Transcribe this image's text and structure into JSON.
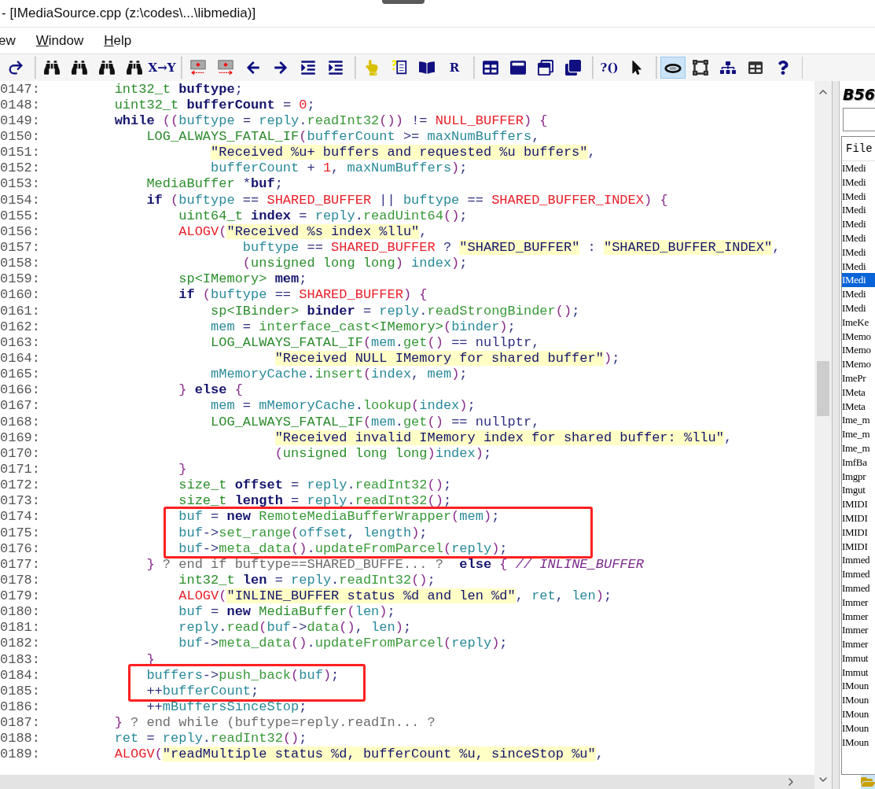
{
  "window": {
    "title": "- [IMediaSource.cpp (z:\\codes\\...\\libmedia)]"
  },
  "menu": [
    {
      "label": "ew",
      "underlined": false
    },
    {
      "label": "Window",
      "underlined": true
    },
    {
      "label": "Help",
      "underlined": true
    }
  ],
  "toolbar": [
    [
      {
        "selected": false
      }
    ],
    [
      {
        "selected": false
      },
      {
        "selected": false
      },
      {
        "selected": false
      },
      {
        "selected": false
      },
      {
        "label": "X→Y",
        "selected": false
      }
    ],
    [
      {
        "selected": false
      },
      {
        "selected": false
      },
      {
        "selected": false
      },
      {
        "selected": false
      },
      {
        "selected": false
      },
      {
        "selected": false
      }
    ],
    [
      {
        "selected": false
      },
      {
        "selected": false
      },
      {
        "selected": false
      },
      {
        "label": "R",
        "selected": false
      }
    ],
    [
      {
        "selected": false
      },
      {
        "selected": false
      },
      {
        "selected": false
      },
      {
        "selected": false
      }
    ],
    [
      {
        "label": "?()",
        "selected": false
      },
      {
        "selected": false
      }
    ],
    [
      {
        "selected": true
      },
      {
        "selected": false
      },
      {
        "selected": false
      },
      {
        "selected": false
      },
      {
        "selected": false
      }
    ]
  ],
  "editor": {
    "lines": [
      {
        "number": "0147:",
        "tokens": [
          {
            "kind": "type",
            "text": "        int32_t "
          },
          {
            "kind": "decl",
            "text": "buftype"
          },
          {
            "kind": "op",
            "text": ";"
          }
        ]
      },
      {
        "number": "0148:",
        "tokens": [
          {
            "kind": "type",
            "text": "        uint32_t "
          },
          {
            "kind": "decl",
            "text": "bufferCount"
          },
          {
            "kind": "op",
            "text": " = "
          },
          {
            "kind": "const",
            "text": "0"
          },
          {
            "kind": "op",
            "text": ";"
          }
        ]
      },
      {
        "number": "0149:",
        "tokens": [
          {
            "kind": "kw",
            "text": "        while "
          },
          {
            "kind": "punct",
            "text": "(("
          },
          {
            "kind": "var",
            "text": "buftype"
          },
          {
            "kind": "op",
            "text": " = "
          },
          {
            "kind": "var",
            "text": "reply"
          },
          {
            "kind": "op",
            "text": "."
          },
          {
            "kind": "func",
            "text": "readInt32"
          },
          {
            "kind": "punct",
            "text": "())"
          },
          {
            "kind": "op",
            "text": " != "
          },
          {
            "kind": "const",
            "text": "NULL_BUFFER"
          },
          {
            "kind": "punct",
            "text": ") {"
          }
        ]
      },
      {
        "number": "0150:",
        "tokens": [
          {
            "kind": "macro",
            "text": "            LOG_ALWAYS_FATAL_IF"
          },
          {
            "kind": "punct",
            "text": "("
          },
          {
            "kind": "var",
            "text": "bufferCount"
          },
          {
            "kind": "op",
            "text": " >= "
          },
          {
            "kind": "var",
            "text": "maxNumBuffers"
          },
          {
            "kind": "op",
            "text": ","
          }
        ]
      },
      {
        "number": "0151:",
        "tokens": [
          {
            "kind": "str",
            "text": "                    \"Received %u+ buffers and requested %u buffers\""
          },
          {
            "kind": "op",
            "text": ","
          }
        ]
      },
      {
        "number": "0152:",
        "tokens": [
          {
            "kind": "var",
            "text": "                    bufferCount"
          },
          {
            "kind": "op",
            "text": " + "
          },
          {
            "kind": "const",
            "text": "1"
          },
          {
            "kind": "op",
            "text": ", "
          },
          {
            "kind": "var",
            "text": "maxNumBuffers"
          },
          {
            "kind": "punct",
            "text": ")"
          },
          {
            "kind": "op",
            "text": ";"
          }
        ]
      },
      {
        "number": "0153:",
        "tokens": [
          {
            "kind": "type",
            "text": "            MediaBuffer"
          },
          {
            "kind": "op",
            "text": " *"
          },
          {
            "kind": "decl",
            "text": "buf"
          },
          {
            "kind": "op",
            "text": ";"
          }
        ]
      },
      {
        "number": "0154:",
        "tokens": [
          {
            "kind": "kw",
            "text": "            if "
          },
          {
            "kind": "punct",
            "text": "("
          },
          {
            "kind": "var",
            "text": "buftype"
          },
          {
            "kind": "op",
            "text": " == "
          },
          {
            "kind": "const",
            "text": "SHARED_BUFFER"
          },
          {
            "kind": "op",
            "text": " || "
          },
          {
            "kind": "var",
            "text": "buftype"
          },
          {
            "kind": "op",
            "text": " == "
          },
          {
            "kind": "const",
            "text": "SHARED_BUFFER_INDEX"
          },
          {
            "kind": "punct",
            "text": ") {"
          }
        ]
      },
      {
        "number": "0155:",
        "tokens": [
          {
            "kind": "type",
            "text": "                uint64_t "
          },
          {
            "kind": "decl",
            "text": "index"
          },
          {
            "kind": "op",
            "text": " = "
          },
          {
            "kind": "var",
            "text": "reply"
          },
          {
            "kind": "op",
            "text": "."
          },
          {
            "kind": "func",
            "text": "readUint64"
          },
          {
            "kind": "punct",
            "text": "()"
          },
          {
            "kind": "op",
            "text": ";"
          }
        ]
      },
      {
        "number": "0156:",
        "tokens": [
          {
            "kind": "const",
            "text": "                ALOGV"
          },
          {
            "kind": "punct",
            "text": "("
          },
          {
            "kind": "str",
            "text": "\"Received %s index %llu\""
          },
          {
            "kind": "op",
            "text": ","
          }
        ]
      },
      {
        "number": "0157:",
        "tokens": [
          {
            "kind": "var",
            "text": "                        buftype"
          },
          {
            "kind": "op",
            "text": " == "
          },
          {
            "kind": "const",
            "text": "SHARED_BUFFER"
          },
          {
            "kind": "op",
            "text": " ? "
          },
          {
            "kind": "str",
            "text": "\"SHARED_BUFFER\""
          },
          {
            "kind": "op",
            "text": " : "
          },
          {
            "kind": "str",
            "text": "\"SHARED_BUFFER_INDEX\""
          },
          {
            "kind": "op",
            "text": ","
          }
        ]
      },
      {
        "number": "0158:",
        "tokens": [
          {
            "kind": "punct",
            "text": "                        ("
          },
          {
            "kind": "type",
            "text": "unsigned long long"
          },
          {
            "kind": "punct",
            "text": ") "
          },
          {
            "kind": "var",
            "text": "index"
          },
          {
            "kind": "punct",
            "text": ")"
          },
          {
            "kind": "op",
            "text": ";"
          }
        ]
      },
      {
        "number": "0159:",
        "tokens": [
          {
            "kind": "type",
            "text": "                sp<IMemory> "
          },
          {
            "kind": "decl",
            "text": "mem"
          },
          {
            "kind": "op",
            "text": ";"
          }
        ]
      },
      {
        "number": "0160:",
        "tokens": [
          {
            "kind": "kw",
            "text": "                if "
          },
          {
            "kind": "punct",
            "text": "("
          },
          {
            "kind": "var",
            "text": "buftype"
          },
          {
            "kind": "op",
            "text": " == "
          },
          {
            "kind": "const",
            "text": "SHARED_BUFFER"
          },
          {
            "kind": "punct",
            "text": ") {"
          }
        ]
      },
      {
        "number": "0161:",
        "tokens": [
          {
            "kind": "type",
            "text": "                    sp<IBinder> "
          },
          {
            "kind": "decl",
            "text": "binder"
          },
          {
            "kind": "op",
            "text": " = "
          },
          {
            "kind": "var",
            "text": "reply"
          },
          {
            "kind": "op",
            "text": "."
          },
          {
            "kind": "func",
            "text": "readStrongBinder"
          },
          {
            "kind": "punct",
            "text": "()"
          },
          {
            "kind": "op",
            "text": ";"
          }
        ]
      },
      {
        "number": "0162:",
        "tokens": [
          {
            "kind": "var",
            "text": "                    mem"
          },
          {
            "kind": "op",
            "text": " = "
          },
          {
            "kind": "func",
            "text": "interface_cast"
          },
          {
            "kind": "type",
            "text": "<IMemory>"
          },
          {
            "kind": "punct",
            "text": "("
          },
          {
            "kind": "var",
            "text": "binder"
          },
          {
            "kind": "punct",
            "text": ")"
          },
          {
            "kind": "op",
            "text": ";"
          }
        ]
      },
      {
        "number": "0163:",
        "tokens": [
          {
            "kind": "macro",
            "text": "                    LOG_ALWAYS_FATAL_IF"
          },
          {
            "kind": "punct",
            "text": "("
          },
          {
            "kind": "var",
            "text": "mem"
          },
          {
            "kind": "op",
            "text": "."
          },
          {
            "kind": "func",
            "text": "get"
          },
          {
            "kind": "punct",
            "text": "()"
          },
          {
            "kind": "op",
            "text": " == nullptr,"
          }
        ]
      },
      {
        "number": "0164:",
        "tokens": [
          {
            "kind": "str",
            "text": "                            \"Received NULL IMemory for shared buffer\""
          },
          {
            "kind": "punct",
            "text": ")"
          },
          {
            "kind": "op",
            "text": ";"
          }
        ]
      },
      {
        "number": "0165:",
        "tokens": [
          {
            "kind": "var",
            "text": "                    mMemoryCache"
          },
          {
            "kind": "op",
            "text": "."
          },
          {
            "kind": "func",
            "text": "insert"
          },
          {
            "kind": "punct",
            "text": "("
          },
          {
            "kind": "var",
            "text": "index"
          },
          {
            "kind": "op",
            "text": ", "
          },
          {
            "kind": "var",
            "text": "mem"
          },
          {
            "kind": "punct",
            "text": ")"
          },
          {
            "kind": "op",
            "text": ";"
          }
        ]
      },
      {
        "number": "0166:",
        "tokens": [
          {
            "kind": "punct",
            "text": "                } "
          },
          {
            "kind": "kw",
            "text": "else "
          },
          {
            "kind": "punct",
            "text": "{"
          }
        ]
      },
      {
        "number": "0167:",
        "tokens": [
          {
            "kind": "var",
            "text": "                    mem"
          },
          {
            "kind": "op",
            "text": " = "
          },
          {
            "kind": "var",
            "text": "mMemoryCache"
          },
          {
            "kind": "op",
            "text": "."
          },
          {
            "kind": "func",
            "text": "lookup"
          },
          {
            "kind": "punct",
            "text": "("
          },
          {
            "kind": "var",
            "text": "index"
          },
          {
            "kind": "punct",
            "text": ")"
          },
          {
            "kind": "op",
            "text": ";"
          }
        ]
      },
      {
        "number": "0168:",
        "tokens": [
          {
            "kind": "macro",
            "text": "                    LOG_ALWAYS_FATAL_IF"
          },
          {
            "kind": "punct",
            "text": "("
          },
          {
            "kind": "var",
            "text": "mem"
          },
          {
            "kind": "op",
            "text": "."
          },
          {
            "kind": "func",
            "text": "get"
          },
          {
            "kind": "punct",
            "text": "()"
          },
          {
            "kind": "op",
            "text": " == nullptr,"
          }
        ]
      },
      {
        "number": "0169:",
        "tokens": [
          {
            "kind": "str",
            "text": "                            \"Received invalid IMemory index for shared buffer: %llu\""
          },
          {
            "kind": "op",
            "text": ","
          }
        ]
      },
      {
        "number": "0170:",
        "tokens": [
          {
            "kind": "punct",
            "text": "                            ("
          },
          {
            "kind": "type",
            "text": "unsigned long long"
          },
          {
            "kind": "punct",
            "text": ")"
          },
          {
            "kind": "var",
            "text": "index"
          },
          {
            "kind": "punct",
            "text": ")"
          },
          {
            "kind": "op",
            "text": ";"
          }
        ]
      },
      {
        "number": "0171:",
        "tokens": [
          {
            "kind": "punct",
            "text": "                }"
          }
        ]
      },
      {
        "number": "0172:",
        "tokens": [
          {
            "kind": "type",
            "text": "                size_t "
          },
          {
            "kind": "decl",
            "text": "offset"
          },
          {
            "kind": "op",
            "text": " = "
          },
          {
            "kind": "var",
            "text": "reply"
          },
          {
            "kind": "op",
            "text": "."
          },
          {
            "kind": "func",
            "text": "readInt32"
          },
          {
            "kind": "punct",
            "text": "()"
          },
          {
            "kind": "op",
            "text": ";"
          }
        ]
      },
      {
        "number": "0173:",
        "tokens": [
          {
            "kind": "type",
            "text": "                size_t "
          },
          {
            "kind": "decl",
            "text": "length"
          },
          {
            "kind": "op",
            "text": " = "
          },
          {
            "kind": "var",
            "text": "reply"
          },
          {
            "kind": "op",
            "text": "."
          },
          {
            "kind": "func",
            "text": "readInt32"
          },
          {
            "kind": "punct",
            "text": "()"
          },
          {
            "kind": "op",
            "text": ";"
          }
        ]
      },
      {
        "number": "0174:",
        "tokens": [
          {
            "kind": "var",
            "text": "                buf"
          },
          {
            "kind": "op",
            "text": " = "
          },
          {
            "kind": "kw",
            "text": "new "
          },
          {
            "kind": "func",
            "text": "RemoteMediaBufferWrapper"
          },
          {
            "kind": "punct",
            "text": "("
          },
          {
            "kind": "var",
            "text": "mem"
          },
          {
            "kind": "punct",
            "text": ")"
          },
          {
            "kind": "op",
            "text": ";"
          }
        ]
      },
      {
        "number": "0175:",
        "tokens": [
          {
            "kind": "var",
            "text": "                buf"
          },
          {
            "kind": "op",
            "text": "->"
          },
          {
            "kind": "func",
            "text": "set_range"
          },
          {
            "kind": "punct",
            "text": "("
          },
          {
            "kind": "var",
            "text": "offset"
          },
          {
            "kind": "op",
            "text": ", "
          },
          {
            "kind": "var",
            "text": "length"
          },
          {
            "kind": "punct",
            "text": ")"
          },
          {
            "kind": "op",
            "text": ";"
          }
        ]
      },
      {
        "number": "0176:",
        "tokens": [
          {
            "kind": "var",
            "text": "                buf"
          },
          {
            "kind": "op",
            "text": "->"
          },
          {
            "kind": "func",
            "text": "meta_data"
          },
          {
            "kind": "punct",
            "text": "()"
          },
          {
            "kind": "op",
            "text": "."
          },
          {
            "kind": "func",
            "text": "updateFromParcel"
          },
          {
            "kind": "punct",
            "text": "("
          },
          {
            "kind": "var",
            "text": "reply"
          },
          {
            "kind": "punct",
            "text": ")"
          },
          {
            "kind": "op",
            "text": ";"
          }
        ]
      },
      {
        "number": "0177:",
        "tokens": [
          {
            "kind": "punct",
            "text": "            } "
          },
          {
            "kind": "comment",
            "text": "? end if buftype==SHARED_BUFFE... ?  "
          },
          {
            "kind": "kw",
            "text": "else "
          },
          {
            "kind": "punct",
            "text": "{ "
          },
          {
            "kind": "note",
            "text": "// INLINE_BUFFER"
          }
        ]
      },
      {
        "number": "0178:",
        "tokens": [
          {
            "kind": "type",
            "text": "                int32_t "
          },
          {
            "kind": "decl",
            "text": "len"
          },
          {
            "kind": "op",
            "text": " = "
          },
          {
            "kind": "var",
            "text": "reply"
          },
          {
            "kind": "op",
            "text": "."
          },
          {
            "kind": "func",
            "text": "readInt32"
          },
          {
            "kind": "punct",
            "text": "()"
          },
          {
            "kind": "op",
            "text": ";"
          }
        ]
      },
      {
        "number": "0179:",
        "tokens": [
          {
            "kind": "const",
            "text": "                ALOGV"
          },
          {
            "kind": "punct",
            "text": "("
          },
          {
            "kind": "str",
            "text": "\"INLINE_BUFFER status %d and len %d\""
          },
          {
            "kind": "op",
            "text": ", "
          },
          {
            "kind": "var",
            "text": "ret"
          },
          {
            "kind": "op",
            "text": ", "
          },
          {
            "kind": "var",
            "text": "len"
          },
          {
            "kind": "punct",
            "text": ")"
          },
          {
            "kind": "op",
            "text": ";"
          }
        ]
      },
      {
        "number": "0180:",
        "tokens": [
          {
            "kind": "var",
            "text": "                buf"
          },
          {
            "kind": "op",
            "text": " = "
          },
          {
            "kind": "kw",
            "text": "new "
          },
          {
            "kind": "type",
            "text": "MediaBuffer"
          },
          {
            "kind": "punct",
            "text": "("
          },
          {
            "kind": "var",
            "text": "len"
          },
          {
            "kind": "punct",
            "text": ")"
          },
          {
            "kind": "op",
            "text": ";"
          }
        ]
      },
      {
        "number": "0181:",
        "tokens": [
          {
            "kind": "var",
            "text": "                reply"
          },
          {
            "kind": "op",
            "text": "."
          },
          {
            "kind": "func",
            "text": "read"
          },
          {
            "kind": "punct",
            "text": "("
          },
          {
            "kind": "var",
            "text": "buf"
          },
          {
            "kind": "op",
            "text": "->"
          },
          {
            "kind": "func",
            "text": "data"
          },
          {
            "kind": "punct",
            "text": "()"
          },
          {
            "kind": "op",
            "text": ", "
          },
          {
            "kind": "var",
            "text": "len"
          },
          {
            "kind": "punct",
            "text": ")"
          },
          {
            "kind": "op",
            "text": ";"
          }
        ]
      },
      {
        "number": "0182:",
        "tokens": [
          {
            "kind": "var",
            "text": "                buf"
          },
          {
            "kind": "op",
            "text": "->"
          },
          {
            "kind": "func",
            "text": "meta_data"
          },
          {
            "kind": "punct",
            "text": "()"
          },
          {
            "kind": "op",
            "text": "."
          },
          {
            "kind": "func",
            "text": "updateFromParcel"
          },
          {
            "kind": "punct",
            "text": "("
          },
          {
            "kind": "var",
            "text": "reply"
          },
          {
            "kind": "punct",
            "text": ")"
          },
          {
            "kind": "op",
            "text": ";"
          }
        ]
      },
      {
        "number": "0183:",
        "tokens": [
          {
            "kind": "punct",
            "text": "            }"
          }
        ]
      },
      {
        "number": "0184:",
        "tokens": [
          {
            "kind": "var",
            "text": "            buffers"
          },
          {
            "kind": "op",
            "text": "->"
          },
          {
            "kind": "func",
            "text": "push_back"
          },
          {
            "kind": "punct",
            "text": "("
          },
          {
            "kind": "var",
            "text": "buf"
          },
          {
            "kind": "punct",
            "text": ")"
          },
          {
            "kind": "op",
            "text": ";"
          }
        ]
      },
      {
        "number": "0185:",
        "tokens": [
          {
            "kind": "op",
            "text": "            ++"
          },
          {
            "kind": "var",
            "text": "bufferCount"
          },
          {
            "kind": "op",
            "text": ";"
          }
        ]
      },
      {
        "number": "0186:",
        "tokens": [
          {
            "kind": "op",
            "text": "            ++"
          },
          {
            "kind": "var",
            "text": "mBuffersSinceStop"
          },
          {
            "kind": "op",
            "text": ";"
          }
        ]
      },
      {
        "number": "0187:",
        "tokens": [
          {
            "kind": "punct",
            "text": "        } "
          },
          {
            "kind": "comment",
            "text": "? end while (buftype=reply.readIn... ?"
          }
        ]
      },
      {
        "number": "0188:",
        "tokens": [
          {
            "kind": "var",
            "text": "        ret"
          },
          {
            "kind": "op",
            "text": " = "
          },
          {
            "kind": "var",
            "text": "reply"
          },
          {
            "kind": "op",
            "text": "."
          },
          {
            "kind": "func",
            "text": "readInt32"
          },
          {
            "kind": "punct",
            "text": "()"
          },
          {
            "kind": "op",
            "text": ";"
          }
        ]
      },
      {
        "number": "0189:",
        "tokens": [
          {
            "kind": "const",
            "text": "        ALOGV"
          },
          {
            "kind": "punct",
            "text": "("
          },
          {
            "kind": "str",
            "text": "\"readMultiple status %d, bufferCount %u, sinceStop %u\""
          },
          {
            "kind": "op",
            "text": ","
          }
        ]
      }
    ]
  },
  "side_panel": {
    "title": "B56",
    "list_header": "File",
    "items": [
      {
        "label": "IMedi",
        "selected": false
      },
      {
        "label": "IMedi",
        "selected": false
      },
      {
        "label": "IMedi",
        "selected": false
      },
      {
        "label": "IMedi",
        "selected": false
      },
      {
        "label": "IMedi",
        "selected": false
      },
      {
        "label": "IMedi",
        "selected": false
      },
      {
        "label": "IMedi",
        "selected": false
      },
      {
        "label": "IMedi",
        "selected": false
      },
      {
        "label": "IMedi",
        "selected": true
      },
      {
        "label": "IMedi",
        "selected": false
      },
      {
        "label": "IMedi",
        "selected": false
      },
      {
        "label": "ImeKe",
        "selected": false
      },
      {
        "label": "IMemo",
        "selected": false
      },
      {
        "label": "IMemo",
        "selected": false
      },
      {
        "label": "IMemo",
        "selected": false
      },
      {
        "label": "ImePr",
        "selected": false
      },
      {
        "label": "IMeta",
        "selected": false
      },
      {
        "label": "IMeta",
        "selected": false
      },
      {
        "label": "Ime_m",
        "selected": false
      },
      {
        "label": "Ime_m",
        "selected": false
      },
      {
        "label": "Ime_m",
        "selected": false
      },
      {
        "label": "ImfBa",
        "selected": false
      },
      {
        "label": "Imgpr",
        "selected": false
      },
      {
        "label": "Imgut",
        "selected": false
      },
      {
        "label": "IMIDI",
        "selected": false
      },
      {
        "label": "IMIDI",
        "selected": false
      },
      {
        "label": "IMIDI",
        "selected": false
      },
      {
        "label": "IMIDI",
        "selected": false
      },
      {
        "label": "Immed",
        "selected": false
      },
      {
        "label": "Immed",
        "selected": false
      },
      {
        "label": "Immed",
        "selected": false
      },
      {
        "label": "Immer",
        "selected": false
      },
      {
        "label": "Immer",
        "selected": false
      },
      {
        "label": "Immer",
        "selected": false
      },
      {
        "label": "Immer",
        "selected": false
      },
      {
        "label": "Immut",
        "selected": false
      },
      {
        "label": "Immut",
        "selected": false
      },
      {
        "label": "IMoun",
        "selected": false
      },
      {
        "label": "IMoun",
        "selected": false
      },
      {
        "label": "IMoun",
        "selected": false
      },
      {
        "label": "IMoun",
        "selected": false
      },
      {
        "label": "IMoun",
        "selected": false
      }
    ]
  }
}
